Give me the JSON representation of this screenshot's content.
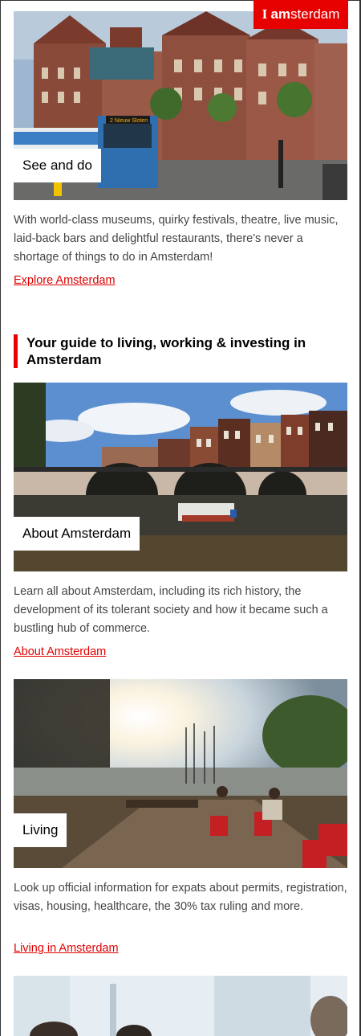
{
  "brand": {
    "logo_prefix": "I ",
    "logo_am": "am",
    "logo_rest": "sterdam",
    "accent": "#e60000"
  },
  "cards": [
    {
      "label": "See and do",
      "description": "With world-class museums, quirky festivals, theatre, live music, laid-back bars and delightful restaurants, there's never a shortage of things to do in Amsterdam!",
      "link": "Explore Amsterdam",
      "tram_sign": "2 Nieuw Sloten"
    },
    {
      "label": "About Amsterdam",
      "description": "Learn all about Amsterdam, including its rich history, the development of its tolerant society and how it became such a bustling hub of commerce.",
      "link": "About Amsterdam"
    },
    {
      "label": "Living",
      "description": "Look up official information for expats about permits, registration, visas, housing, healthcare, the 30% tax ruling and more.",
      "link": "Living in Amsterdam"
    }
  ],
  "guide_heading": "Your guide to living, working & investing in Amsterdam"
}
